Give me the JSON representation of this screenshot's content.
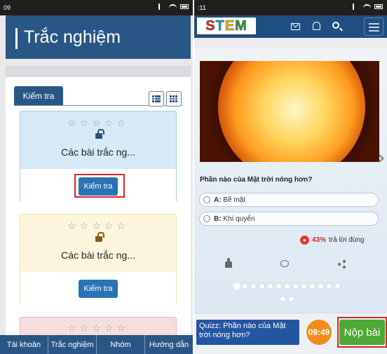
{
  "left": {
    "status_time": "09",
    "header_title": "Trắc nghiệm",
    "tab_label": "Kiểm tra",
    "cards": [
      {
        "stars": "☆☆☆☆☆",
        "title": "Các bài trắc ng...",
        "button": "Kiểm tra",
        "bg": "#d6eaf8",
        "border": "#a9cde6",
        "lock_color": "#2f4f75"
      },
      {
        "stars": "☆☆☆☆☆",
        "title": "Các bài trắc ng...",
        "button": "Kiểm tra",
        "bg": "#fdf6dc",
        "border": "#efe1a8",
        "lock_color": "#8a5a14"
      },
      {
        "stars": "☆☆☆☆☆",
        "title": "",
        "button": "",
        "bg": "#f7dede",
        "border": "#e6b9b9"
      }
    ],
    "nav": [
      "Tài khoản",
      "Trắc nghiệm",
      "Nhóm",
      "Hướng dẫn"
    ]
  },
  "right": {
    "status_time": ":11",
    "logo_letters": [
      "S",
      "T",
      "E",
      "M"
    ],
    "logo_colors": [
      "#e4322b",
      "#2a9fd8",
      "#f7c21a",
      "#38a84a"
    ],
    "question": "Phần nào của Mặt trời nóng hơn?",
    "options": [
      {
        "key": "A:",
        "text": " Bề mặt"
      },
      {
        "key": "B:",
        "text": " Khí quyển"
      }
    ],
    "stat_percent": "43%",
    "stat_text": "trả lời đúng",
    "quiz_label": "Quizz: Phần nào của Mặt trời nóng hơn?",
    "timer": "09:49",
    "submit": "Nộp bài"
  },
  "icons": {
    "left_view": [
      "list-view-icon",
      "grid-view-icon"
    ],
    "right_topbar": [
      "mail-icon",
      "bell-icon",
      "search-icon",
      "menu-icon"
    ],
    "actions": [
      "like-icon",
      "comment-icon",
      "share-icon"
    ]
  }
}
